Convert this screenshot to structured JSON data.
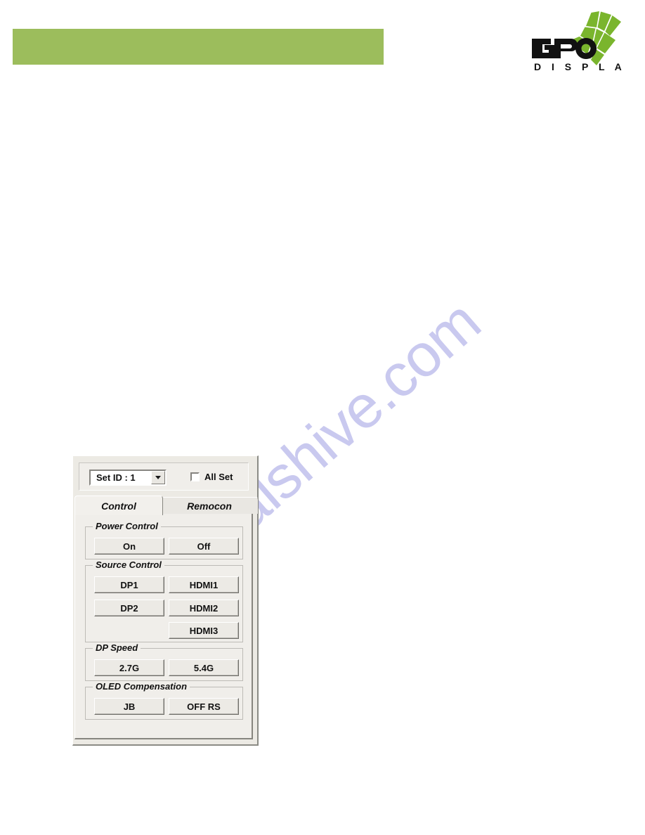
{
  "page": {
    "header_bar_color": "#9cbd5c",
    "background_color": "#ffffff"
  },
  "logo": {
    "name": "GPO Display",
    "primary_text": "GPO",
    "secondary_text": "D I S P L A Y",
    "mark_color": "#7ab52d",
    "text_color": "#111111"
  },
  "watermark": {
    "text": "manualshive.com",
    "color": "#c9c9ef"
  },
  "dialog": {
    "top_bar": {
      "set_id_combo": {
        "value": "Set ID : 1",
        "arrow_icon": "chevron-down-icon"
      },
      "all_set_checkbox": {
        "label": "All Set",
        "checked": false
      }
    },
    "tabs": [
      {
        "label": "Control",
        "selected": true
      },
      {
        "label": "Remocon",
        "selected": false
      }
    ],
    "groups": [
      {
        "title": "Power Control",
        "buttons": [
          {
            "label": "On",
            "column": "left"
          },
          {
            "label": "Off",
            "column": "right"
          }
        ]
      },
      {
        "title": "Source Control",
        "buttons": [
          {
            "label": "DP1",
            "column": "left"
          },
          {
            "label": "HDMI1",
            "column": "right"
          },
          {
            "label": "DP2",
            "column": "left"
          },
          {
            "label": "HDMI2",
            "column": "right"
          },
          {
            "label": "HDMI3",
            "column": "right"
          }
        ]
      },
      {
        "title": "DP Speed",
        "buttons": [
          {
            "label": "2.7G",
            "column": "left"
          },
          {
            "label": "5.4G",
            "column": "right"
          }
        ]
      },
      {
        "title": "OLED Compensation",
        "buttons": [
          {
            "label": "JB",
            "column": "left"
          },
          {
            "label": "OFF RS",
            "column": "right"
          }
        ]
      }
    ]
  }
}
